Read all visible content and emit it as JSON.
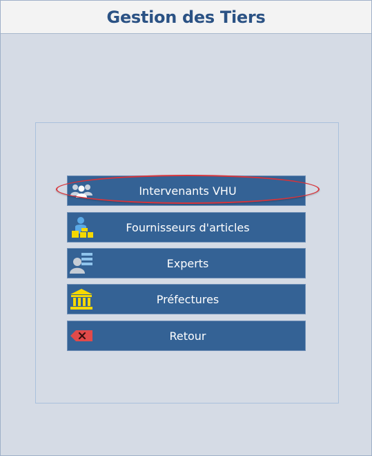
{
  "window": {
    "title": "Gestion des Tiers"
  },
  "menu": {
    "items": [
      {
        "label": "Intervenants VHU",
        "icon": "group-users-icon"
      },
      {
        "label": "Fournisseurs d'articles",
        "icon": "supplier-person-boxes-icon"
      },
      {
        "label": "Experts",
        "icon": "expert-person-list-icon"
      },
      {
        "label": "Préfectures",
        "icon": "prefecture-building-icon"
      },
      {
        "label": "Retour",
        "icon": "back-delete-icon"
      }
    ]
  },
  "colors": {
    "title_text": "#2b5284",
    "title_bar_bg": "#f3f3f3",
    "window_bg": "#d5dbe5",
    "button_bg": "#346295",
    "button_text": "#ffffff",
    "icon_yellow": "#f5d800",
    "highlight": "#d8343a"
  }
}
